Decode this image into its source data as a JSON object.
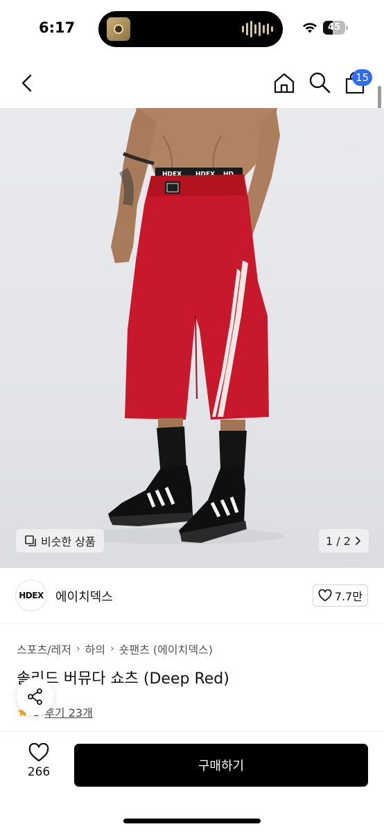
{
  "status_bar": {
    "time": "6:17",
    "battery_level": "45",
    "battery_fraction": 0.45
  },
  "nav": {
    "back_icon": "chevron-left-icon",
    "home_icon": "home-icon",
    "search_icon": "search-icon",
    "cart_icon": "shopping-bag-icon",
    "cart_count": "15"
  },
  "product_image": {
    "similar_label": "비슷한 상품",
    "pager": "1 / 2",
    "garment_color": "#c8192c"
  },
  "brand": {
    "logo_text": "HDEX",
    "name": "에이치덱스",
    "likes": "7.7만"
  },
  "breadcrumb": [
    "스포츠/레저",
    "하의",
    "숏팬츠 (에이치덱스)"
  ],
  "product": {
    "title": "솔리드 버뮤다 쇼츠 (Deep Red)",
    "rating": "5",
    "reviews": "후기 23개"
  },
  "bottom": {
    "wish_count": "266",
    "buy_label": "구매하기"
  },
  "colors": {
    "accent_badge": "#2f6bff",
    "buy_button": "#000000",
    "star": "#f5a623"
  }
}
